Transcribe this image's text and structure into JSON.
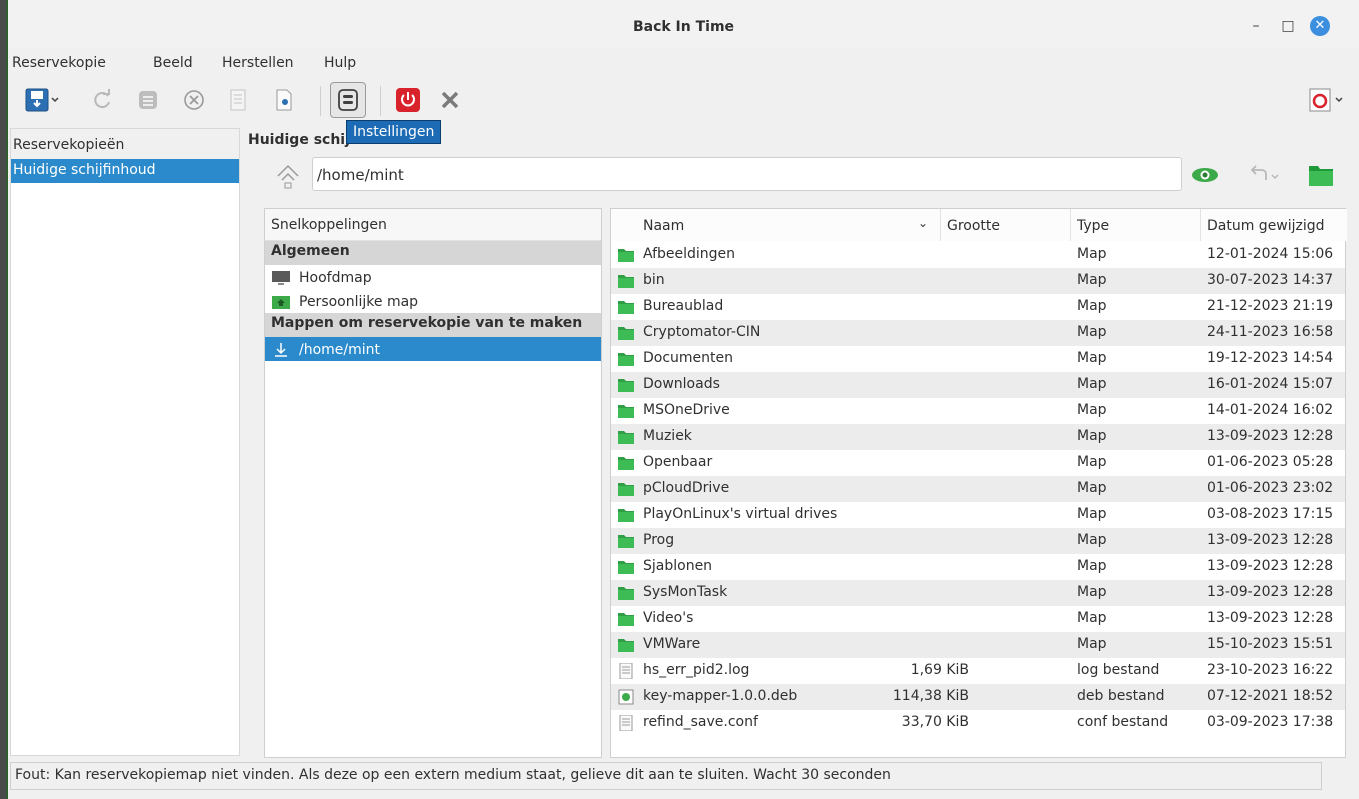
{
  "window": {
    "title": "Back In Time",
    "minimize": "–",
    "maximize": "□",
    "close": "✕"
  },
  "menubar": [
    "Reservekopie",
    "Beeld",
    "Herstellen",
    "Hulp"
  ],
  "toolbar": {
    "tooltip": "Instellingen",
    "icons": [
      "take-snapshot-icon",
      "refresh-icon",
      "snapshot-name-icon",
      "remove-snapshot-icon",
      "view-log-icon",
      "view-last-log-icon",
      "settings-icon",
      "shutdown-icon",
      "exit-icon",
      "help-icon"
    ]
  },
  "left_pane": {
    "header": "Reservekopieën",
    "items": [
      "Huidige schijfinhoud"
    ]
  },
  "main": {
    "header": "Huidige schijfinhoud",
    "path": "/home/mint"
  },
  "shortcuts": {
    "header": "Snelkoppelingen",
    "group1": "Algemeen",
    "home": "Hoofdmap",
    "personal": "Persoonlijke map",
    "group2": "Mappen om reservekopie van te maken",
    "backup_dir": "/home/mint"
  },
  "files": {
    "columns": [
      "Naam",
      "Grootte",
      "Type",
      "Datum gewijzigd"
    ],
    "rows": [
      {
        "name": "Afbeeldingen",
        "size": "",
        "type": "Map",
        "date": "12-01-2024 15:06",
        "kind": "folder"
      },
      {
        "name": "bin",
        "size": "",
        "type": "Map",
        "date": "30-07-2023 14:37",
        "kind": "folder"
      },
      {
        "name": "Bureaublad",
        "size": "",
        "type": "Map",
        "date": "21-12-2023 21:19",
        "kind": "folder"
      },
      {
        "name": "Cryptomator-CIN",
        "size": "",
        "type": "Map",
        "date": "24-11-2023 16:58",
        "kind": "folder"
      },
      {
        "name": "Documenten",
        "size": "",
        "type": "Map",
        "date": "19-12-2023 14:54",
        "kind": "folder"
      },
      {
        "name": "Downloads",
        "size": "",
        "type": "Map",
        "date": "16-01-2024 15:07",
        "kind": "folder"
      },
      {
        "name": "MSOneDrive",
        "size": "",
        "type": "Map",
        "date": "14-01-2024 16:02",
        "kind": "folder"
      },
      {
        "name": "Muziek",
        "size": "",
        "type": "Map",
        "date": "13-09-2023 12:28",
        "kind": "folder"
      },
      {
        "name": "Openbaar",
        "size": "",
        "type": "Map",
        "date": "01-06-2023 05:28",
        "kind": "folder"
      },
      {
        "name": "pCloudDrive",
        "size": "",
        "type": "Map",
        "date": "01-06-2023 23:02",
        "kind": "folder"
      },
      {
        "name": "PlayOnLinux's virtual drives",
        "size": "",
        "type": "Map",
        "date": "03-08-2023 17:15",
        "kind": "folder"
      },
      {
        "name": "Prog",
        "size": "",
        "type": "Map",
        "date": "13-09-2023 12:28",
        "kind": "folder"
      },
      {
        "name": "Sjablonen",
        "size": "",
        "type": "Map",
        "date": "13-09-2023 12:28",
        "kind": "folder"
      },
      {
        "name": "SysMonTask",
        "size": "",
        "type": "Map",
        "date": "13-09-2023 12:28",
        "kind": "folder"
      },
      {
        "name": "Video's",
        "size": "",
        "type": "Map",
        "date": "13-09-2023 12:28",
        "kind": "folder"
      },
      {
        "name": "VMWare",
        "size": "",
        "type": "Map",
        "date": "15-10-2023 15:51",
        "kind": "folder"
      },
      {
        "name": "hs_err_pid2.log",
        "size": "1,69 KiB",
        "type": "log bestand",
        "date": "23-10-2023 16:22",
        "kind": "file"
      },
      {
        "name": "key-mapper-1.0.0.deb",
        "size": "114,38 KiB",
        "type": "deb bestand",
        "date": "07-12-2021 18:52",
        "kind": "deb"
      },
      {
        "name": "refind_save.conf",
        "size": "33,70 KiB",
        "type": "conf bestand",
        "date": "03-09-2023 17:38",
        "kind": "file"
      }
    ]
  },
  "status": "Fout: Kan reservekopiemap niet vinden. Als deze op een extern medium staat, gelieve dit aan te sluiten. Wacht 30 seconden",
  "colors": {
    "accent": "#2a8acb",
    "folder": "#3daa4a",
    "danger": "#d9232c",
    "close": "#3c8fde"
  }
}
